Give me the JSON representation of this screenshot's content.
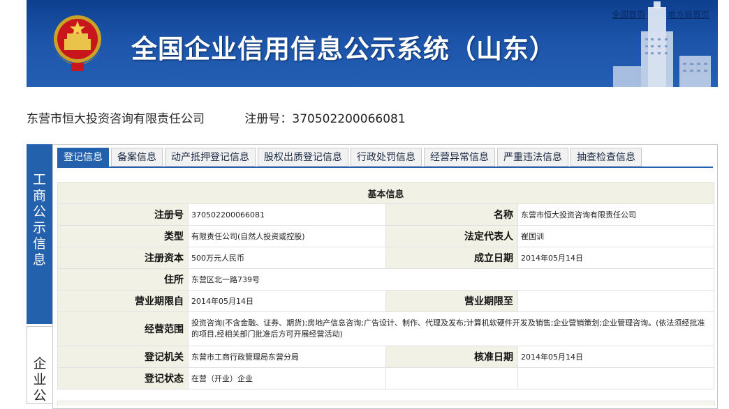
{
  "header": {
    "title": "全国企业信用信息公示系统（山东）",
    "links": [
      "全国首页",
      "地方局首页"
    ],
    "colors": {
      "banner": "#1c54a9",
      "tab_active": "#2361ac",
      "label_bg": "#f1f1e5"
    }
  },
  "company": {
    "name": "东营市恒大投资咨询有限责任公司",
    "reg_label": "注册号：370502200066081"
  },
  "side_tabs": {
    "active": "工商公示信息",
    "inactive": "企业公"
  },
  "tabs": [
    "登记信息",
    "备案信息",
    "动产抵押登记信息",
    "股权出质登记信息",
    "行政处罚信息",
    "经营异常信息",
    "严重违法信息",
    "抽查检查信息"
  ],
  "basic_info": {
    "heading": "基本信息",
    "reg_no_label": "注册号",
    "reg_no": "370502200066081",
    "name_label": "名称",
    "name": "东营市恒大投资咨询有限责任公司",
    "type_label": "类型",
    "type": "有限责任公司(自然人投资或控股)",
    "legal_rep_label": "法定代表人",
    "legal_rep": "崔国训",
    "capital_label": "注册资本",
    "capital": "500万元人民币",
    "founded_label": "成立日期",
    "founded": "2014年05月14日",
    "address_label": "住所",
    "address": "东营区北一路739号",
    "term_from_label": "营业期限自",
    "term_from": "2014年05月14日",
    "term_to_label": "营业期限至",
    "term_to": "",
    "scope_label": "经营范围",
    "scope": "投资咨询(不含金融、证券、期货);房地产信息咨询;广告设计、制作、代理及发布;计算机软硬件开发及销售;企业营销策划;企业管理咨询。(依法须经批准的项目,经相关部门批准后方可开展经营活动)",
    "authority_label": "登记机关",
    "authority": "东营市工商行政管理局东营分局",
    "approved_label": "核准日期",
    "approved": "2014年05月14日",
    "status_label": "登记状态",
    "status": "在营（开业）企业"
  }
}
